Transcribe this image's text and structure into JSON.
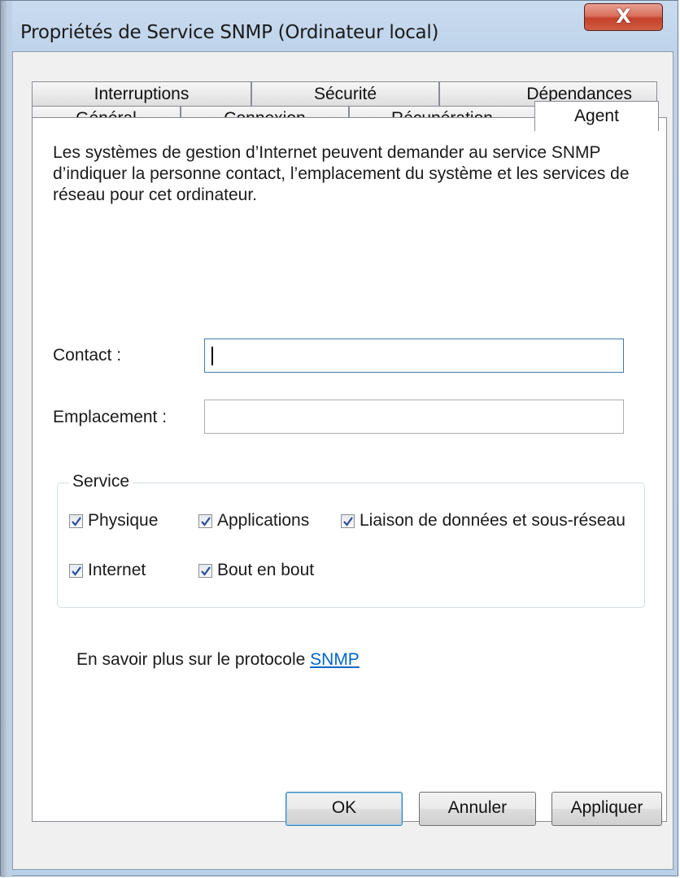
{
  "window": {
    "title": "Propriétés de Service SNMP (Ordinateur local)",
    "close_glyph": "X"
  },
  "tabs": {
    "back_row": [
      "Interruptions",
      "Sécurité",
      "Dépendances"
    ],
    "front_row": [
      "Général",
      "Connexion",
      "Récupération",
      "Agent"
    ],
    "active": "Agent"
  },
  "agent": {
    "description": "Les systèmes de gestion d’Internet peuvent demander au service SNMP d’indiquer la personne contact, l’emplacement du système et les services de réseau pour cet ordinateur.",
    "contact_label": "Contact :",
    "contact_value": "",
    "location_label": "Emplacement :",
    "location_value": "",
    "service_group_label": "Service",
    "services": [
      {
        "label": "Physique",
        "checked": true
      },
      {
        "label": "Applications",
        "checked": true
      },
      {
        "label": "Liaison de données et sous-réseau",
        "checked": true
      },
      {
        "label": "Internet",
        "checked": true
      },
      {
        "label": "Bout en bout",
        "checked": true
      }
    ],
    "info_text": "En savoir plus sur le protocole ",
    "info_link": "SNMP"
  },
  "buttons": {
    "ok": "OK",
    "cancel": "Annuler",
    "apply": "Appliquer"
  },
  "colors": {
    "link": "#0066cc",
    "check": "#2b4e97",
    "close_button": "#c4412a"
  }
}
